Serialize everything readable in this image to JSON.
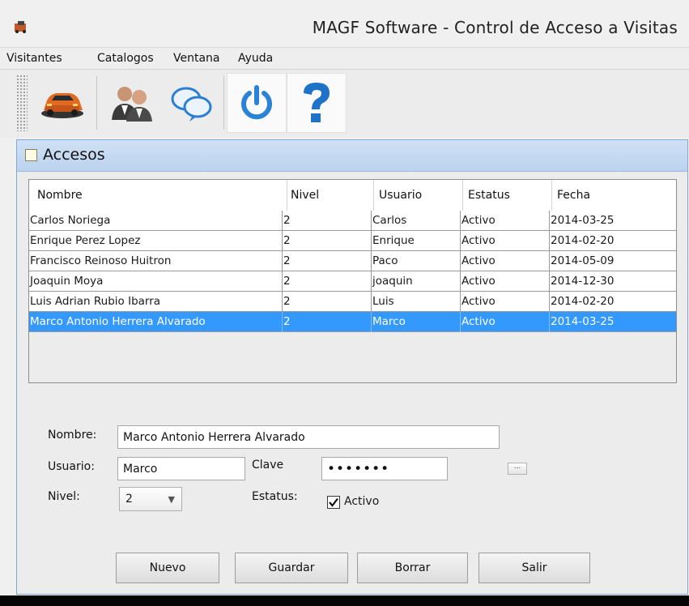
{
  "window": {
    "title": "MAGF Software - Control de Acceso a Visitas"
  },
  "menu": [
    "Visitantes",
    "Catalogos",
    "Ventana",
    "Ayuda"
  ],
  "toolbar": {
    "buttons": [
      {
        "icon": "car-icon"
      },
      {
        "icon": "users-icon"
      },
      {
        "icon": "chat-bubbles-icon"
      },
      {
        "icon": "power-icon"
      },
      {
        "icon": "help-icon"
      }
    ]
  },
  "internal_frame": {
    "title": "Accesos"
  },
  "table": {
    "columns": [
      "Nombre",
      "Nivel",
      "Usuario",
      "Estatus",
      "Fecha"
    ],
    "rows": [
      {
        "nombre": "Carlos Noriega",
        "nivel": "2",
        "usuario": "Carlos",
        "estatus": "Activo",
        "fecha": "2014-03-25"
      },
      {
        "nombre": "Enrique Perez Lopez",
        "nivel": "2",
        "usuario": "Enrique",
        "estatus": "Activo",
        "fecha": "2014-02-20"
      },
      {
        "nombre": "Francisco Reinoso Huitron",
        "nivel": "2",
        "usuario": "Paco",
        "estatus": "Activo",
        "fecha": "2014-05-09"
      },
      {
        "nombre": "Joaquin Moya",
        "nivel": "2",
        "usuario": "joaquin",
        "estatus": "Activo",
        "fecha": "2014-12-30"
      },
      {
        "nombre": "Luis Adrian Rubio Ibarra",
        "nivel": "2",
        "usuario": "Luis",
        "estatus": "Activo",
        "fecha": "2014-02-20"
      },
      {
        "nombre": "Marco Antonio Herrera Alvarado",
        "nivel": "2",
        "usuario": "Marco",
        "estatus": "Activo",
        "fecha": "2014-03-25"
      }
    ],
    "selected_row": 5
  },
  "form": {
    "nombre_label": "Nombre:",
    "nombre_value": "Marco Antonio Herrera Alvarado",
    "usuario_label": "Usuario:",
    "usuario_value": "Marco",
    "clave_label": "Clave",
    "clave_value": "•••••••",
    "browse_label": "...",
    "nivel_label": "Nivel:",
    "nivel_value": "2",
    "estatus_label": "Estatus:",
    "activo_label": "Activo",
    "activo_checked": true
  },
  "buttons": {
    "nuevo": "Nuevo",
    "guardar": "Guardar",
    "borrar": "Borrar",
    "salir": "Salir"
  },
  "colors": {
    "selection": "#3399ff",
    "frame_title": "#c6dbf2",
    "help_icon": "#1e73c8"
  }
}
